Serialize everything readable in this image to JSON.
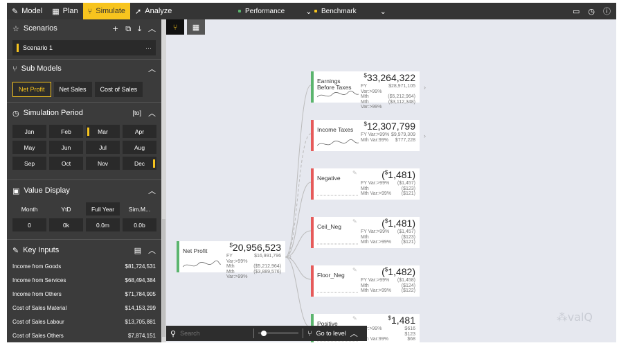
{
  "topbar": {
    "nav": [
      {
        "label": "Model",
        "icon": "pencil-icon"
      },
      {
        "label": "Plan",
        "icon": "table-icon"
      },
      {
        "label": "Simulate",
        "icon": "branch-icon"
      },
      {
        "label": "Analyze",
        "icon": "rocket-icon"
      }
    ],
    "performance_label": "Performance",
    "benchmark_label": "Benchmark",
    "colors": {
      "performance": "#5bb56e",
      "benchmark": "#f7c41e",
      "accent": "#f7c41e"
    }
  },
  "sidebar": {
    "scenarios": {
      "title": "Scenarios",
      "items": [
        {
          "label": "Scenario 1",
          "more": "···"
        }
      ]
    },
    "sub_models": {
      "title": "Sub Models",
      "items": [
        "Net Profit",
        "Net Sales",
        "Cost of Sales"
      ],
      "active": "Net Profit"
    },
    "simulation_period": {
      "title": "Simulation Period",
      "badge": "[to]",
      "months": [
        "Jan",
        "Feb",
        "Mar",
        "Apr",
        "May",
        "Jun",
        "Jul",
        "Aug",
        "Sep",
        "Oct",
        "Nov",
        "Dec"
      ]
    },
    "value_display": {
      "title": "Value Display",
      "headers": [
        "Month",
        "YtD",
        "Full Year",
        "Sim.M..."
      ],
      "values": [
        "0",
        "0k",
        "0.0m",
        "0.0b"
      ]
    },
    "key_inputs": {
      "title": "Key Inputs",
      "items": [
        {
          "label": "Income from Goods",
          "value": "$81,724,531"
        },
        {
          "label": "Income from Services",
          "value": "$68,494,384"
        },
        {
          "label": "Income from Others",
          "value": "$71,784,905"
        },
        {
          "label": "Cost of Sales Material",
          "value": "$14,153,299"
        },
        {
          "label": "Cost of Sales Labour",
          "value": "$13,705,881"
        },
        {
          "label": "Cost of Sales Others",
          "value": "$7,874,151"
        }
      ]
    }
  },
  "canvas": {
    "root": {
      "name": "Net Profit",
      "value": "20,956,523",
      "lines": [
        [
          "FY Var:>99%",
          "$16,991,796"
        ],
        [
          "Mth",
          "($5,212,964)"
        ],
        [
          "Mth Var:>99%",
          "($3,889,576)"
        ]
      ]
    },
    "nodes": [
      {
        "name": "Earnings Before Taxes",
        "value": "33,264,322",
        "color": "green",
        "lines": [
          [
            "FY Var:>99%",
            "$28,971,105"
          ],
          [
            "Mth",
            "($5,212,964)"
          ],
          [
            "Mth Var:>99%",
            "($3,112,348)"
          ]
        ]
      },
      {
        "name": "Income Taxes",
        "value": "12,307,799",
        "color": "red",
        "lines": [
          [
            "FY Var:>99%",
            "$9,979,309"
          ],
          [
            "",
            ""
          ],
          [
            "Mth Var:99%",
            "$777,228"
          ]
        ]
      },
      {
        "name": "Negative",
        "value": "(1,481)",
        "color": "red",
        "lines": [
          [
            "FY Var:>99%",
            "($1,457)"
          ],
          [
            "Mth",
            "($123)"
          ],
          [
            "Mth Var:>99%",
            "($121)"
          ]
        ]
      },
      {
        "name": "Ceil_Neg",
        "value": "(1,481)",
        "color": "red",
        "lines": [
          [
            "FY Var:>99%",
            "($1,457)"
          ],
          [
            "Mth",
            "($123)"
          ],
          [
            "Mth Var:>99%",
            "($121)"
          ]
        ]
      },
      {
        "name": "Floor_Neg",
        "value": "(1,482)",
        "color": "red",
        "lines": [
          [
            "FY Var:>99%",
            "($1,458)"
          ],
          [
            "Mth",
            "($124)"
          ],
          [
            "Mth Var:>99%",
            "($122)"
          ]
        ]
      },
      {
        "name": "Positive",
        "value": "1,481",
        "color": "green",
        "lines": [
          [
            "Var:>99%",
            "$616"
          ],
          [
            "",
            "$123"
          ],
          [
            "Mth Var:99%",
            "$68"
          ]
        ]
      }
    ],
    "search_placeholder": "Search",
    "goto_label": "Go to level",
    "logo": "valQ",
    "currency": "$"
  }
}
